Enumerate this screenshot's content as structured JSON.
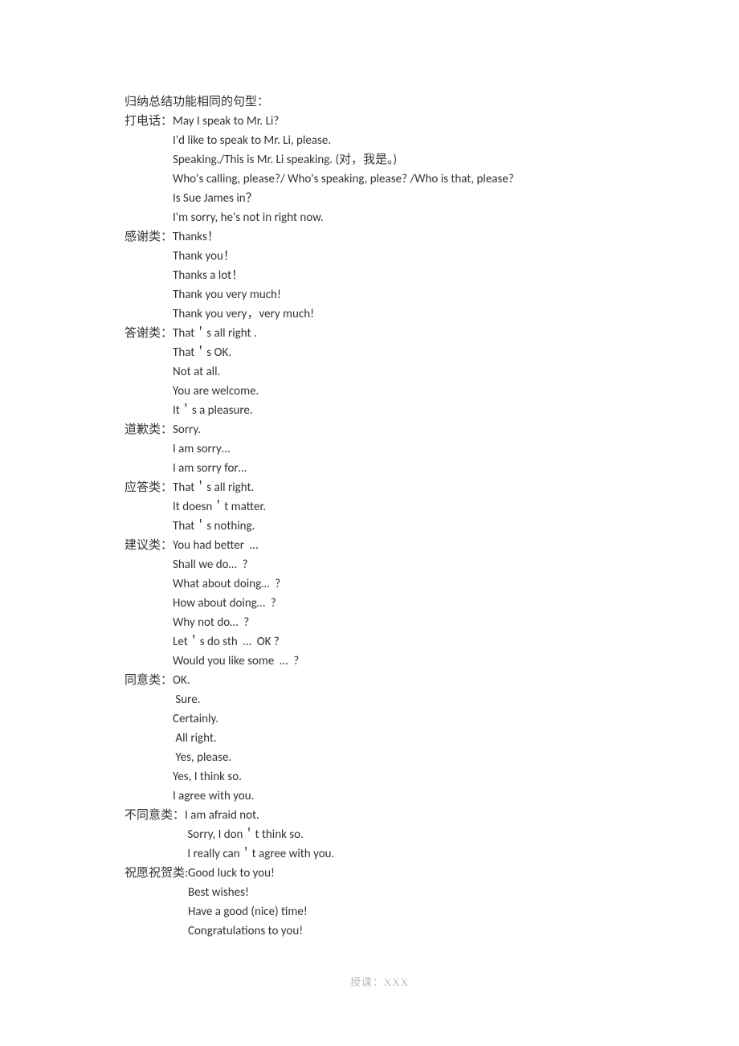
{
  "title": "归纳总结功能相同的句型：",
  "categories": [
    {
      "label": "打电话：",
      "indent": "",
      "items": [
        "May I speak to Mr. Li?",
        "I'd like to speak to Mr. Li, please.",
        "Speaking./This is Mr. Li speaking. (对，我是。)",
        "Who's calling, please?/ Who's speaking, please? /Who is that, please?",
        "Is Sue James in？",
        "I'm sorry, he's not in right now."
      ]
    },
    {
      "label": "感谢类：",
      "indent": "",
      "items": [
        "Thanks！",
        "Thank you！",
        "Thanks a lot！",
        "Thank you very much!",
        "Thank you very，very much!"
      ]
    },
    {
      "label": "答谢类：",
      "indent": "",
      "items": [
        "That＇s all right .",
        "That＇s OK.",
        "Not at all.",
        "You are welcome.",
        "It＇s a pleasure."
      ]
    },
    {
      "label": "道歉类：",
      "indent": "",
      "items": [
        "Sorry.",
        "I am sorry…",
        "I am sorry for…"
      ]
    },
    {
      "label": "应答类：",
      "indent": "",
      "items": [
        "That＇s all right.",
        "It doesn＇t matter.",
        "That＇s nothing."
      ]
    },
    {
      "label": "建议类：",
      "indent": "",
      "items": [
        "You had better  …",
        "Shall we do…  ?",
        "What about doing…  ?",
        "How about doing…  ?",
        "Why not do…  ?",
        "Let＇s do sth  …  OK ?",
        "Would you like some  …  ?"
      ]
    },
    {
      "label": "同意类：",
      "indent": "",
      "items": [
        "OK.",
        " Sure.",
        "Certainly.",
        " All right.",
        " Yes, please.",
        "Yes, I think so.",
        "I agree with you."
      ]
    },
    {
      "label": "不同意类：",
      "indent": "",
      "items": [
        "I am afraid not.",
        " Sorry, I don＇t think so.",
        " I really can＇t agree with you."
      ]
    },
    {
      "label": "祝愿祝贺类:",
      "indent": "    ",
      "items": [
        "Good luck to you!",
        "Best wishes!",
        "Have a good (nice) time!",
        "Congratulations to you!"
      ]
    }
  ],
  "footer": "授课：XXX"
}
